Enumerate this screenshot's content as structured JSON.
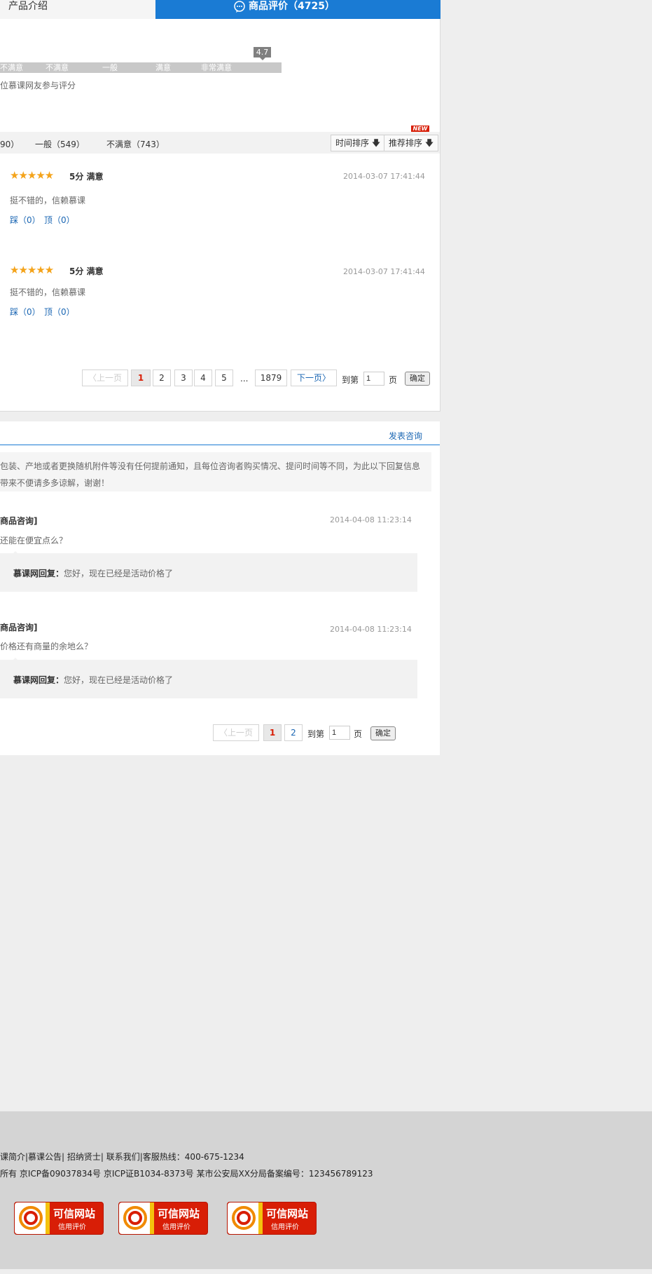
{
  "tabs": {
    "intro": "产品介绍",
    "review": "商品评价（4725）"
  },
  "score": {
    "tip": "4.7",
    "levels": [
      "不满意",
      "不满意",
      "一般",
      "满意",
      "非常满意"
    ],
    "participants": "位慕课网友参与评分"
  },
  "filters": {
    "items": [
      "90）",
      "一般（549）",
      "不满意（743）"
    ],
    "sort_time": "时间排序 🡇",
    "sort_recommend": "推荐排序 🡇",
    "new_badge": "NEW"
  },
  "reviews": [
    {
      "stars": "★★★★★",
      "score": "5分 满意",
      "time": "2014-03-07 17:41:44",
      "text": "挺不错的，信赖慕课",
      "down": "踩（0）",
      "up": "顶（0）"
    },
    {
      "stars": "★★★★★",
      "score": "5分 满意",
      "time": "2014-03-07 17:41:44",
      "text": "挺不错的，信赖慕课",
      "down": "踩（0）",
      "up": "顶（0）"
    }
  ],
  "review_pager": {
    "prev": "〈上一页",
    "pages": [
      "1",
      "2",
      "3",
      "4",
      "5"
    ],
    "ellipsis": "...",
    "last": "1879",
    "next": "下一页〉",
    "goto_label": "到第",
    "goto_value": "1",
    "page_unit": "页",
    "confirm": "确定"
  },
  "consult": {
    "post_link": "发表咨询",
    "notice_line1": "包装、产地或者更换随机附件等没有任何提前通知，且每位咨询者购买情况、提问时间等不同，为此以下回复信息",
    "notice_line2": "带来不便请多多谅解，谢谢！",
    "items": [
      {
        "title": "商品咨询]",
        "time": "2014-04-08 11:23:14",
        "question": "还能在便宜点么？",
        "reply_label": "慕课网回复：",
        "reply": "您好，现在已经是活动价格了"
      },
      {
        "title": "商品咨询]",
        "time": "2014-04-08 11:23:14",
        "question": "价格还有商量的余地么？",
        "reply_label": "慕课网回复：",
        "reply": "您好，现在已经是活动价格了"
      }
    ]
  },
  "consult_pager": {
    "prev": "〈上一页",
    "pages": [
      "1",
      "2"
    ],
    "goto_label": "到第",
    "goto_value": "1",
    "page_unit": "页",
    "confirm": "确定"
  },
  "footer": {
    "line1": "课简介|慕课公告| 招纳贤士| 联系我们|客服热线：400-675-1234",
    "line2": "所有   京ICP备09037834号   京ICP证B1034-8373号   某市公安局XX分局备案编号：123456789123",
    "badge_title": "可信网站",
    "badge_sub": "信用评价"
  },
  "colors": {
    "accent": "#1a7bd4",
    "star": "#f4a31a",
    "badge_red": "#d81e06"
  }
}
